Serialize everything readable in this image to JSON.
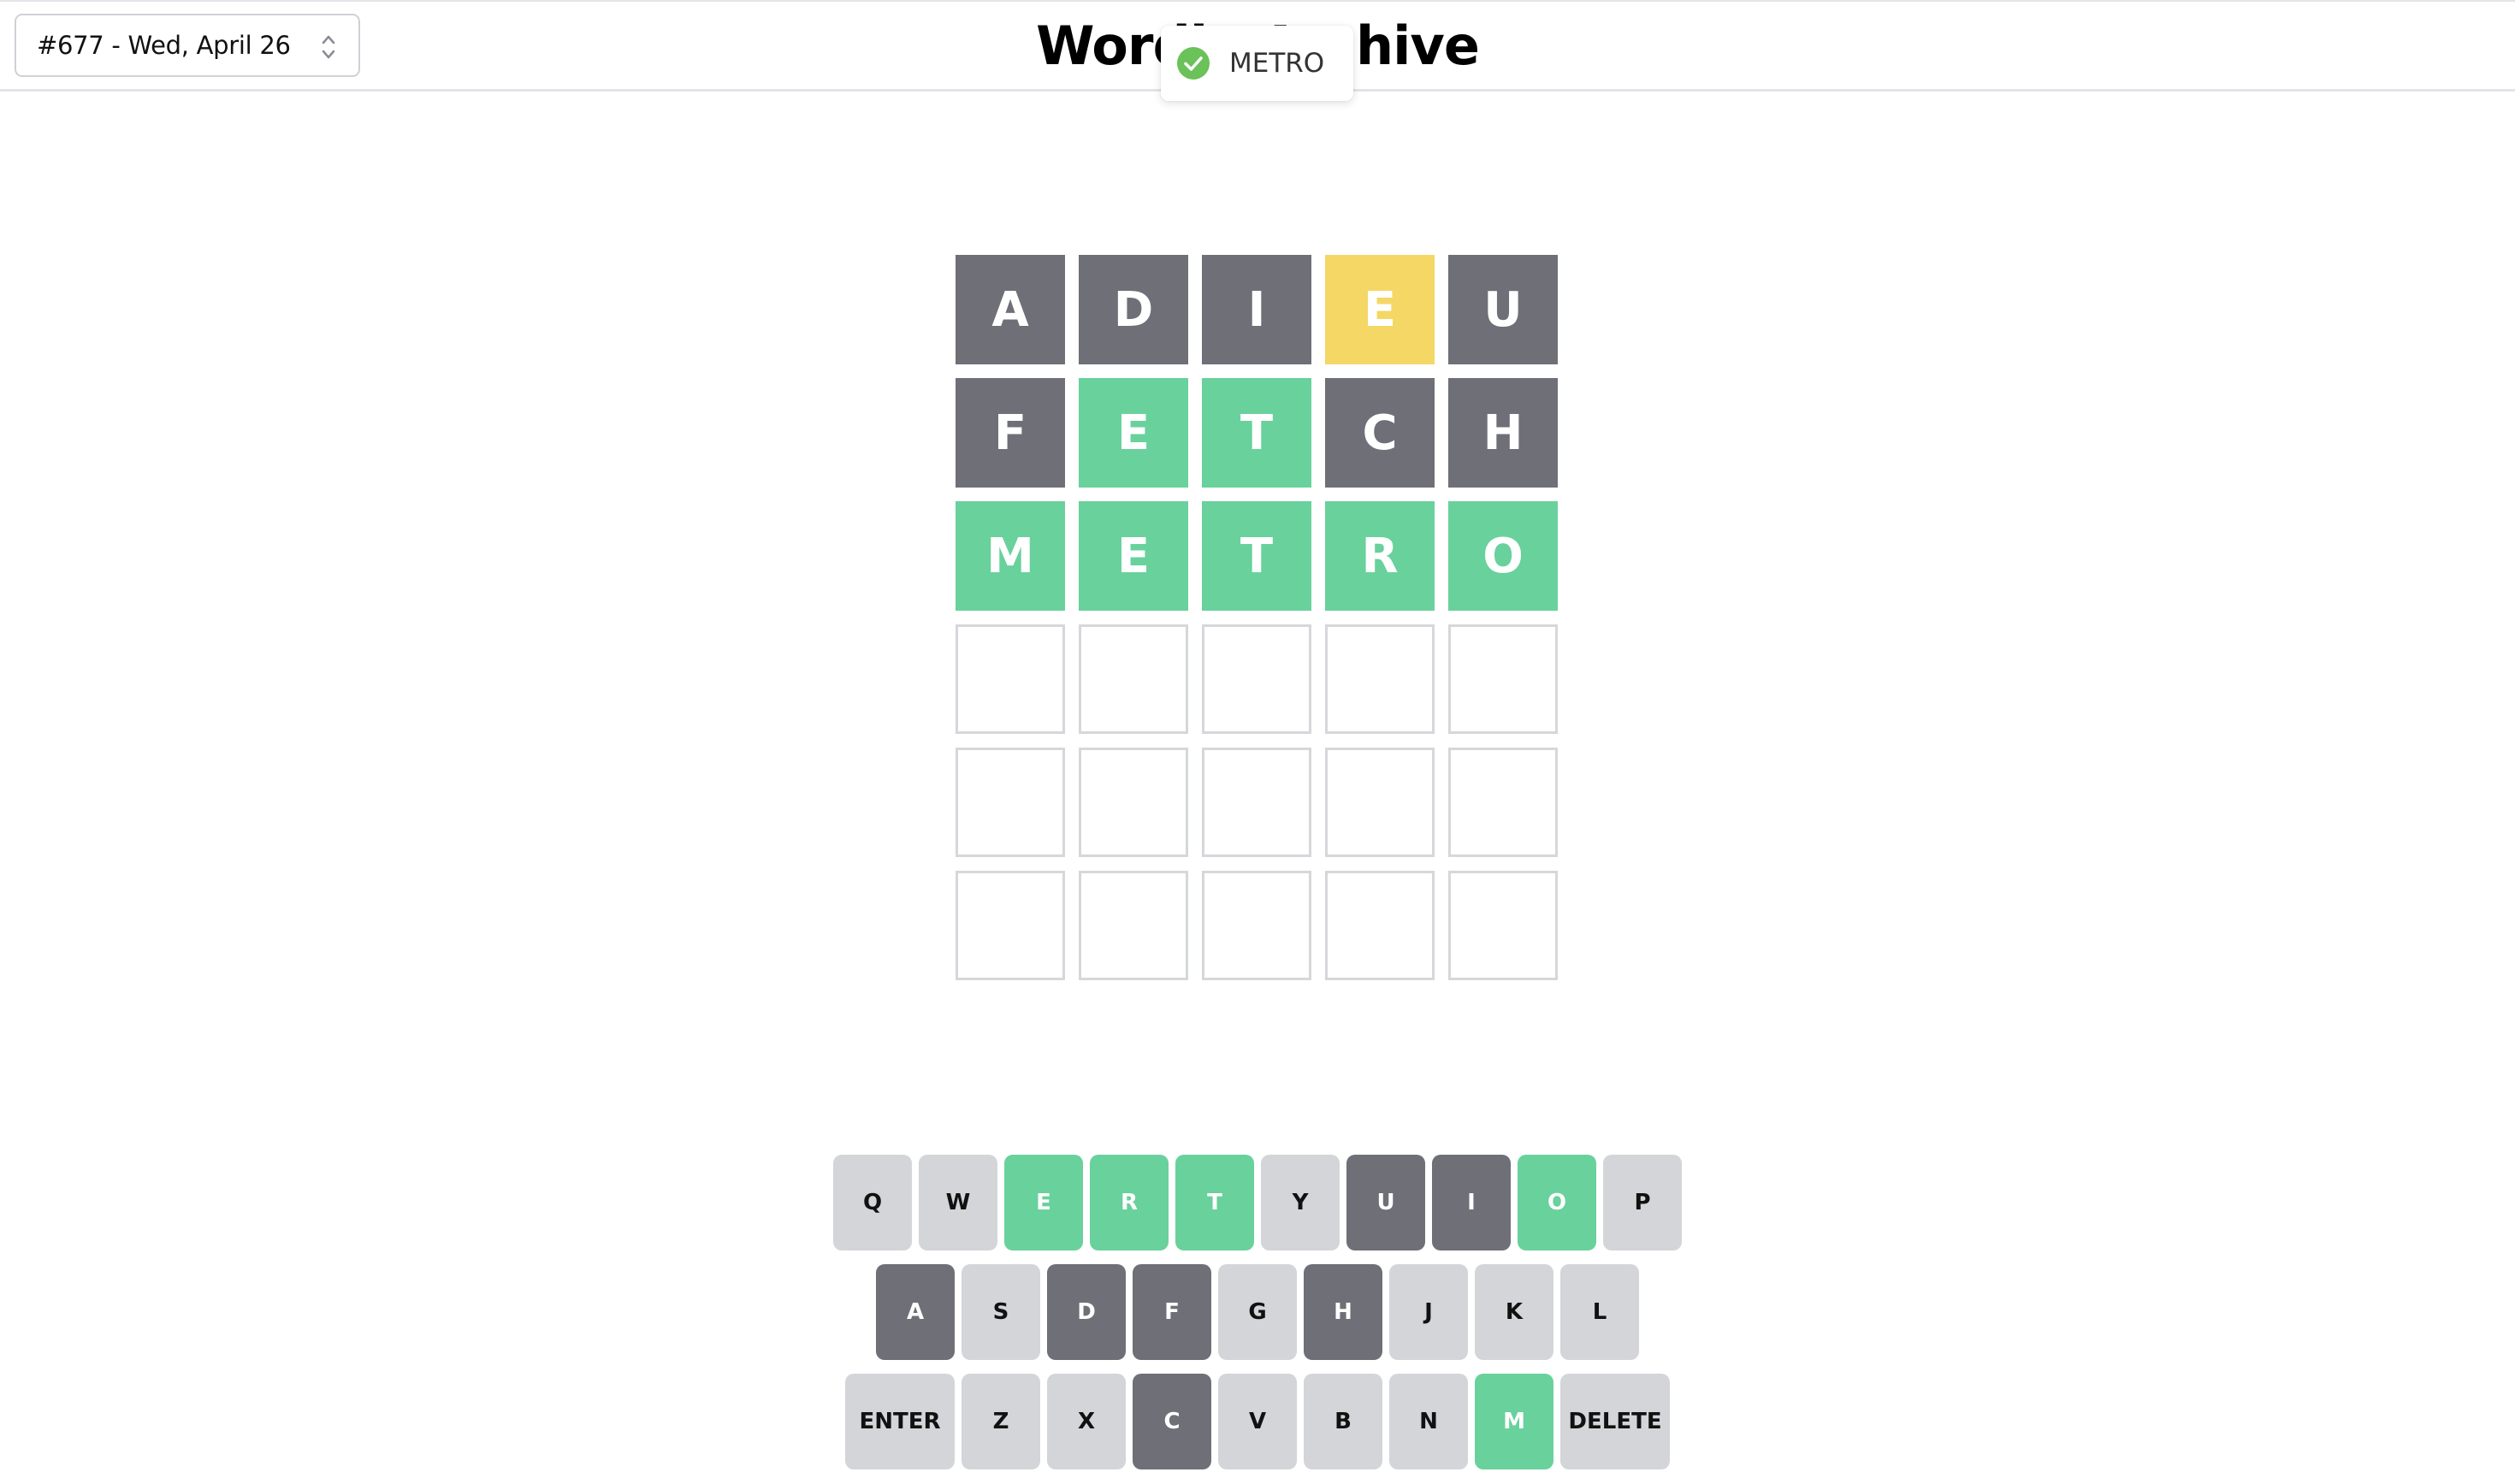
{
  "header": {
    "puzzle_select_value": "#677 - Wed, April 26",
    "title": "Wordle Archive"
  },
  "toast": {
    "message": "METRO",
    "icon": "check-circle-icon",
    "icon_color": "#6ac259"
  },
  "colors": {
    "absent": "#6e6f77",
    "present": "#f4d764",
    "correct": "#69d19c",
    "empty_border": "#d6d7da",
    "key_default": "#d4d5d9"
  },
  "board": {
    "rows": [
      {
        "tiles": [
          {
            "letter": "A",
            "state": "absent"
          },
          {
            "letter": "D",
            "state": "absent"
          },
          {
            "letter": "I",
            "state": "absent"
          },
          {
            "letter": "E",
            "state": "present"
          },
          {
            "letter": "U",
            "state": "absent"
          }
        ]
      },
      {
        "tiles": [
          {
            "letter": "F",
            "state": "absent"
          },
          {
            "letter": "E",
            "state": "correct"
          },
          {
            "letter": "T",
            "state": "correct"
          },
          {
            "letter": "C",
            "state": "absent"
          },
          {
            "letter": "H",
            "state": "absent"
          }
        ]
      },
      {
        "tiles": [
          {
            "letter": "M",
            "state": "correct"
          },
          {
            "letter": "E",
            "state": "correct"
          },
          {
            "letter": "T",
            "state": "correct"
          },
          {
            "letter": "R",
            "state": "correct"
          },
          {
            "letter": "O",
            "state": "correct"
          }
        ]
      },
      {
        "tiles": [
          {
            "letter": "",
            "state": "empty"
          },
          {
            "letter": "",
            "state": "empty"
          },
          {
            "letter": "",
            "state": "empty"
          },
          {
            "letter": "",
            "state": "empty"
          },
          {
            "letter": "",
            "state": "empty"
          }
        ]
      },
      {
        "tiles": [
          {
            "letter": "",
            "state": "empty"
          },
          {
            "letter": "",
            "state": "empty"
          },
          {
            "letter": "",
            "state": "empty"
          },
          {
            "letter": "",
            "state": "empty"
          },
          {
            "letter": "",
            "state": "empty"
          }
        ]
      },
      {
        "tiles": [
          {
            "letter": "",
            "state": "empty"
          },
          {
            "letter": "",
            "state": "empty"
          },
          {
            "letter": "",
            "state": "empty"
          },
          {
            "letter": "",
            "state": "empty"
          },
          {
            "letter": "",
            "state": "empty"
          }
        ]
      }
    ]
  },
  "keyboard": {
    "rows": [
      [
        {
          "label": "Q",
          "state": "default"
        },
        {
          "label": "W",
          "state": "default"
        },
        {
          "label": "E",
          "state": "correct"
        },
        {
          "label": "R",
          "state": "correct"
        },
        {
          "label": "T",
          "state": "correct"
        },
        {
          "label": "Y",
          "state": "default"
        },
        {
          "label": "U",
          "state": "absent"
        },
        {
          "label": "I",
          "state": "absent"
        },
        {
          "label": "O",
          "state": "correct"
        },
        {
          "label": "P",
          "state": "default"
        }
      ],
      [
        {
          "label": "A",
          "state": "absent"
        },
        {
          "label": "S",
          "state": "default"
        },
        {
          "label": "D",
          "state": "absent"
        },
        {
          "label": "F",
          "state": "absent"
        },
        {
          "label": "G",
          "state": "default"
        },
        {
          "label": "H",
          "state": "absent"
        },
        {
          "label": "J",
          "state": "default"
        },
        {
          "label": "K",
          "state": "default"
        },
        {
          "label": "L",
          "state": "default"
        }
      ],
      [
        {
          "label": "ENTER",
          "state": "default",
          "wide": "enter"
        },
        {
          "label": "Z",
          "state": "default"
        },
        {
          "label": "X",
          "state": "default"
        },
        {
          "label": "C",
          "state": "absent"
        },
        {
          "label": "V",
          "state": "default"
        },
        {
          "label": "B",
          "state": "default"
        },
        {
          "label": "N",
          "state": "default"
        },
        {
          "label": "M",
          "state": "correct"
        },
        {
          "label": "DELETE",
          "state": "default",
          "wide": "delete"
        }
      ]
    ]
  }
}
